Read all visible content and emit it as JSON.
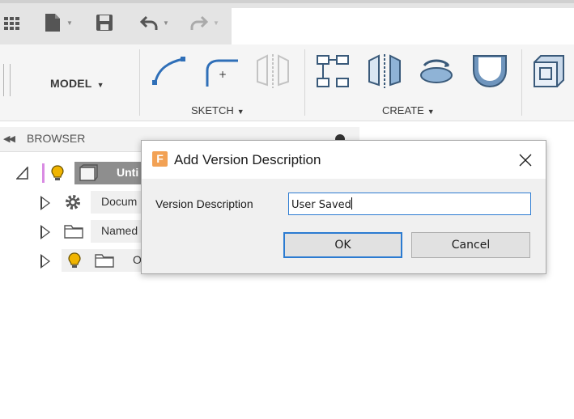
{
  "toolbar": {
    "model_label": "MODEL",
    "sketch_label": "SKETCH",
    "create_label": "CREATE"
  },
  "browser": {
    "title": "BROWSER",
    "items": [
      {
        "label": "Unti"
      },
      {
        "label": "Docum"
      },
      {
        "label": "Named"
      },
      {
        "label": "O"
      }
    ]
  },
  "dialog": {
    "app_icon_letter": "F",
    "title": "Add Version Description",
    "field_label": "Version Description",
    "field_value": "User Saved",
    "ok_label": "OK",
    "cancel_label": "Cancel"
  },
  "colors": {
    "accent": "#2b7bd1",
    "app_icon": "#f2a154",
    "bulb": "#f0b400",
    "component_marker": "#d98be3"
  }
}
